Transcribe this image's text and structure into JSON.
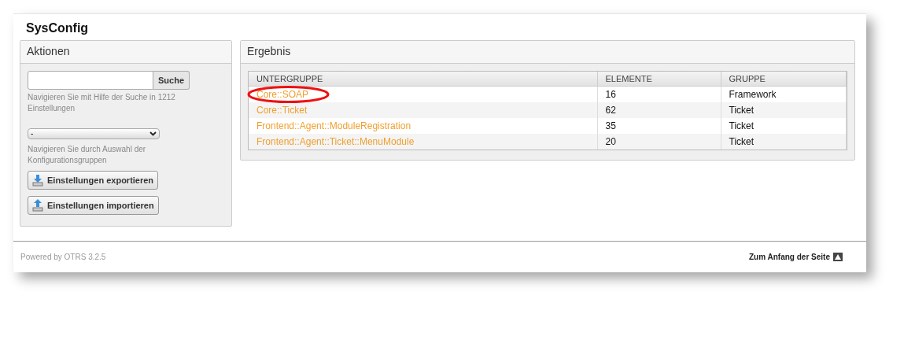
{
  "page_title": "SysConfig",
  "actions": {
    "title": "Aktionen",
    "search": {
      "button": "Suche",
      "hint": "Navigieren Sie mit Hilfe der Suche in 1212 Einstellungen"
    },
    "group_select": {
      "value": "-",
      "hint": "Navigieren Sie durch Auswahl der Konfigurationsgruppen"
    },
    "buttons": [
      {
        "label": "Einstellungen exportieren",
        "kind": "export"
      },
      {
        "label": "Einstellungen importieren",
        "kind": "import"
      }
    ]
  },
  "result": {
    "title": "Ergebnis",
    "columns": [
      "UNTERGRUPPE",
      "ELEMENTE",
      "GRUPPE"
    ],
    "rows": [
      {
        "subgroup": "Core::SOAP",
        "elements": "16",
        "group": "Framework",
        "highlighted": true
      },
      {
        "subgroup": "Core::Ticket",
        "elements": "62",
        "group": "Ticket",
        "highlighted": false
      },
      {
        "subgroup": "Frontend::Agent::ModuleRegistration",
        "elements": "35",
        "group": "Ticket",
        "highlighted": false
      },
      {
        "subgroup": "Frontend::Agent::Ticket::MenuModule",
        "elements": "20",
        "group": "Ticket",
        "highlighted": false
      }
    ]
  },
  "footer": {
    "powered_by": "Powered by OTRS 3.2.5",
    "top_link": "Zum Anfang der Seite"
  }
}
